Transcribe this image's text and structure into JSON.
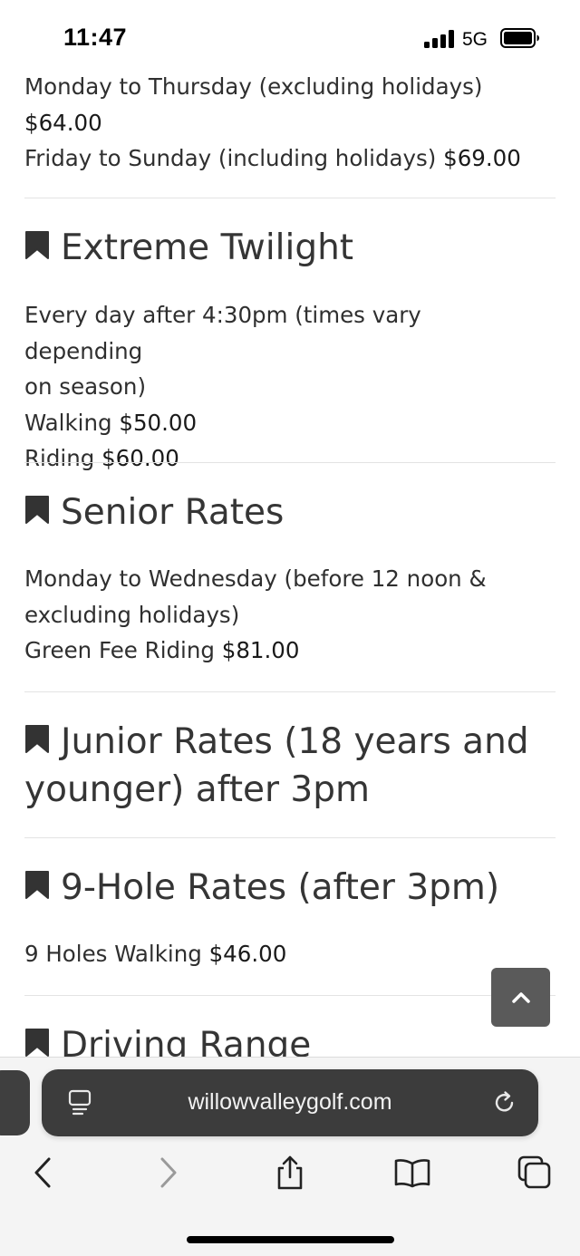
{
  "status_bar": {
    "time": "11:47",
    "network": "5G"
  },
  "top_section": {
    "line1": "Monday to Thursday (excluding holidays)",
    "line1_price": "$64.00",
    "line2": "Friday to Sunday (including holidays)",
    "line2_price": "$69.00"
  },
  "sections": [
    {
      "title": "Extreme Twilight",
      "desc_line1": "Every day after 4:30pm (times vary depending",
      "desc_line2": "on season)",
      "rate1_label": "Walking",
      "rate1_price": "$50.00",
      "rate2_label": "Riding",
      "rate2_price": "$60.00"
    },
    {
      "title": "Senior Rates",
      "desc_line1": "Monday to Wednesday (before 12 noon &",
      "desc_line2": "excluding holidays)",
      "rate1_label": "Green Fee Riding",
      "rate1_price": "$81.00"
    },
    {
      "title_line1": "Junior Rates (18 years and",
      "title_line2": "younger) after 3pm"
    },
    {
      "title": "9-Hole Rates (after 3pm)",
      "rate1_label": "9 Holes Walking",
      "rate1_price": "$46.00"
    },
    {
      "title": "Driving Range"
    }
  ],
  "browser": {
    "url": "willowvalleygolf.com"
  },
  "icons": {
    "bookmark": "bookmark-icon",
    "back_to_top": "chevron-up-icon",
    "page_menu": "page-menu-icon",
    "reload": "reload-icon",
    "back": "chevron-left-icon",
    "forward": "chevron-right-icon",
    "share": "share-icon",
    "bookmarks": "book-icon",
    "tabs": "tabs-icon"
  },
  "colors": {
    "text": "#2f2f2f",
    "heading": "#353535",
    "url_bar": "#3c3c3c",
    "back_to_top": "#5a5a5a"
  }
}
